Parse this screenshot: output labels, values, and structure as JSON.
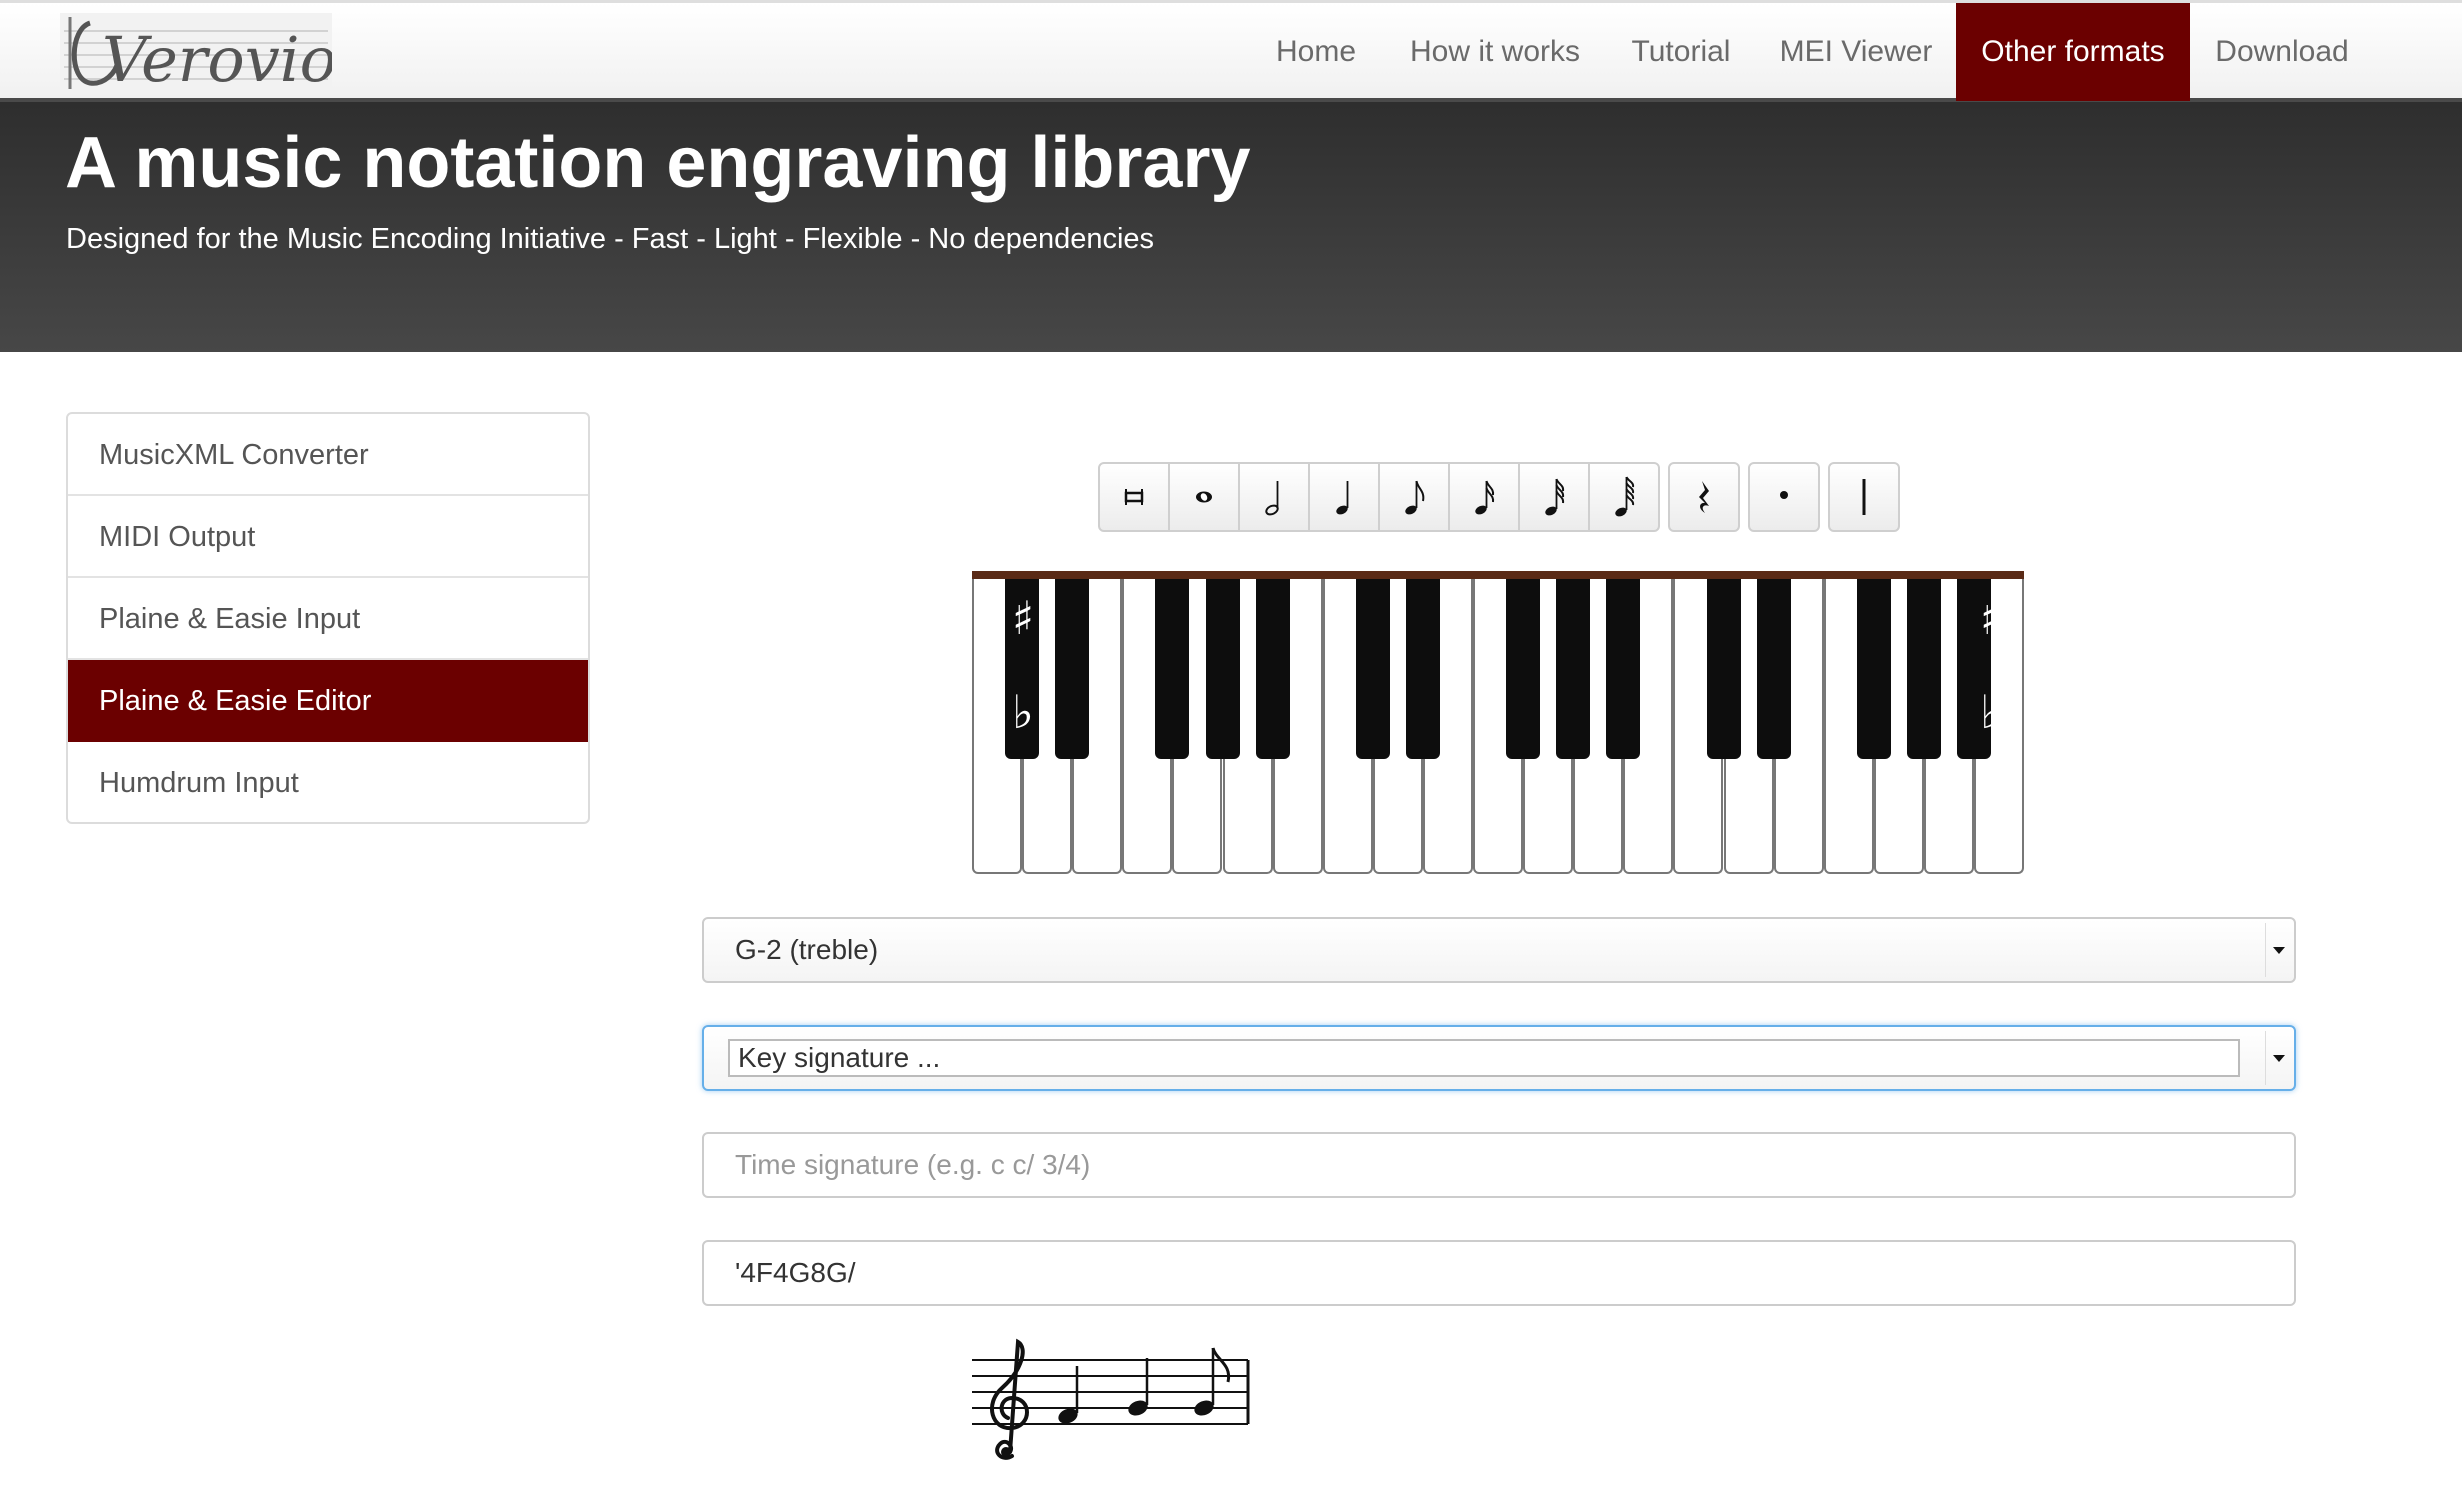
{
  "brand": {
    "logo_text": "Verovio"
  },
  "nav": {
    "items": [
      {
        "label": "Home"
      },
      {
        "label": "How it works"
      },
      {
        "label": "Tutorial"
      },
      {
        "label": "MEI Viewer"
      },
      {
        "label": "Other formats",
        "active": true
      },
      {
        "label": "Download"
      }
    ]
  },
  "hero": {
    "title": "A music notation engraving library",
    "subtitle": "Designed for the Music Encoding Initiative - Fast - Light - Flexible - No dependencies"
  },
  "sidebar": {
    "items": [
      {
        "label": "MusicXML Converter"
      },
      {
        "label": "MIDI Output"
      },
      {
        "label": "Plaine & Easie Input"
      },
      {
        "label": "Plaine & Easie Editor",
        "active": true
      },
      {
        "label": "Humdrum Input"
      }
    ]
  },
  "toolbar": {
    "buttons": [
      {
        "icon": "breve-icon"
      },
      {
        "icon": "whole-note-icon"
      },
      {
        "icon": "half-note-icon"
      },
      {
        "icon": "quarter-note-icon"
      },
      {
        "icon": "eighth-note-icon"
      },
      {
        "icon": "sixteenth-note-icon"
      },
      {
        "icon": "thirty-second-note-icon"
      },
      {
        "icon": "sixty-fourth-note-icon"
      },
      {
        "icon": "rest-icon"
      },
      {
        "icon": "dot-icon"
      },
      {
        "icon": "barline-icon"
      }
    ]
  },
  "keyboard": {
    "sharp_symbol": "♯",
    "flat_symbol": "♭"
  },
  "form": {
    "clef": {
      "value": "G-2 (treble)"
    },
    "key_signature": {
      "value": "Key signature ..."
    },
    "time_signature": {
      "placeholder": "Time signature (e.g. c c/ 3/4)",
      "value": ""
    },
    "data": {
      "value": "'4F4G8G/"
    }
  },
  "colors": {
    "accent": "#6b0000",
    "hero_bg": "#3a3a3a",
    "focus": "#66afe9"
  }
}
